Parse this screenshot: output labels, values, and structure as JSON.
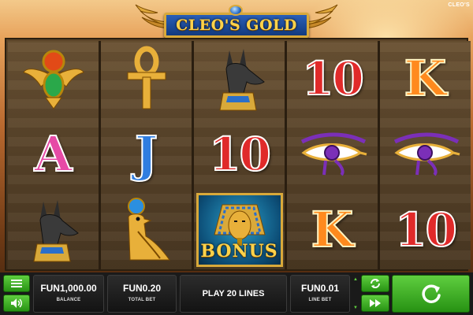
{
  "game": {
    "brand": "CLEO'S",
    "title": "CLEO'S GOLD"
  },
  "reels": [
    [
      "scarab-symbol",
      "A",
      "anubis-symbol"
    ],
    [
      "ankh-symbol",
      "J",
      "falcon-symbol"
    ],
    [
      "anubis-symbol",
      "10",
      "bonus-symbol"
    ],
    [
      "10",
      "eye-of-horus-symbol",
      "K"
    ],
    [
      "K",
      "eye-of-horus-symbol",
      "10"
    ]
  ],
  "bonus_label": "BONUS",
  "controls": {
    "balance_value": "FUN1,000.00",
    "balance_label": "BALANCE",
    "total_bet_value": "FUN0.20",
    "total_bet_label": "TOTAL BET",
    "lines_label": "PLAY 20 LINES",
    "line_bet_value": "FUN0.01",
    "line_bet_label": "LINE BET",
    "menu_icon": "menu-icon",
    "sound_icon": "sound-icon",
    "autoplay_icon": "autoplay-icon",
    "fast_forward_icon": "fast-forward-icon",
    "spin_icon": "spin-icon"
  },
  "colors": {
    "accent_green": "#3fb224",
    "title_blue": "#1e4c9c",
    "gold": "#d9a93a"
  }
}
